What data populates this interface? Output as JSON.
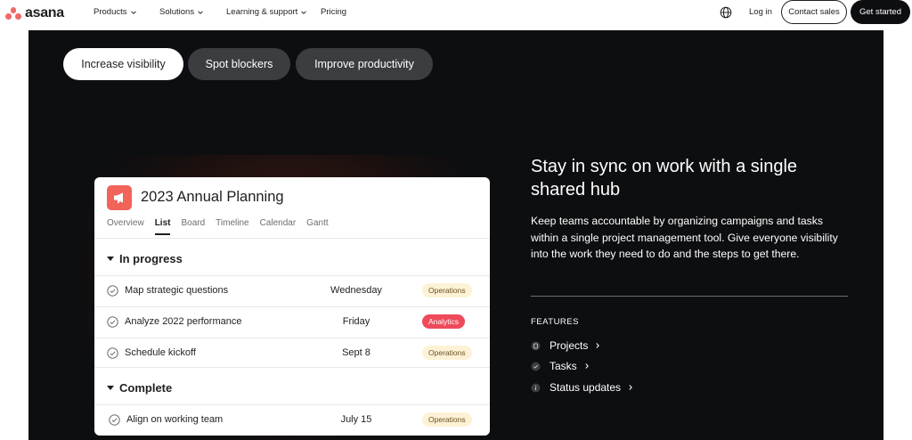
{
  "brand": {
    "name": "asana",
    "logo_color": "#f06a6a"
  },
  "nav": {
    "links": [
      {
        "label": "Products",
        "has_dropdown": true
      },
      {
        "label": "Solutions",
        "has_dropdown": true
      },
      {
        "label": "Learning & support",
        "has_dropdown": true
      },
      {
        "label": "Pricing",
        "has_dropdown": false
      }
    ],
    "language_icon": "globe-icon",
    "login": "Log in",
    "contact_sales": "Contact sales",
    "get_started": "Get started"
  },
  "pills": [
    {
      "label": "Increase visibility",
      "active": true
    },
    {
      "label": "Spot blockers",
      "active": false
    },
    {
      "label": "Improve productivity",
      "active": false
    }
  ],
  "project": {
    "title": "2023 Annual Planning",
    "icon": "megaphone-icon",
    "icon_color": "#f0645a",
    "tabs": [
      "Overview",
      "List",
      "Board",
      "Timeline",
      "Calendar",
      "Gantt"
    ],
    "active_tab": "List",
    "sections": [
      {
        "name": "In progress",
        "tasks": [
          {
            "name": "Map strategic questions",
            "due": "Wednesday",
            "tag": "Operations"
          },
          {
            "name": "Analyze 2022 performance",
            "due": "Friday",
            "tag": "Analytics"
          },
          {
            "name": "Schedule kickoff",
            "due": "Sept 8",
            "tag": "Operations"
          }
        ]
      },
      {
        "name": "Complete",
        "tasks": [
          {
            "name": "Align on working team",
            "due": "July 15",
            "tag": "Operations"
          }
        ]
      }
    ]
  },
  "content": {
    "headline": "Stay in sync on work with a single shared hub",
    "body": "Keep teams accountable by organizing campaigns and tasks within a single project management tool. Give everyone visibility into the work they need to do and the steps to get there.",
    "features_label": "FEATURES",
    "features": [
      {
        "label": "Projects",
        "icon": "clipboard-icon"
      },
      {
        "label": "Tasks",
        "icon": "check-circle-icon"
      },
      {
        "label": "Status updates",
        "icon": "info-circle-icon"
      }
    ]
  },
  "colors": {
    "dark_bg": "#0d0e10",
    "tag_operations_bg": "#fdf2d6",
    "tag_analytics_bg": "#ee4a5b"
  }
}
